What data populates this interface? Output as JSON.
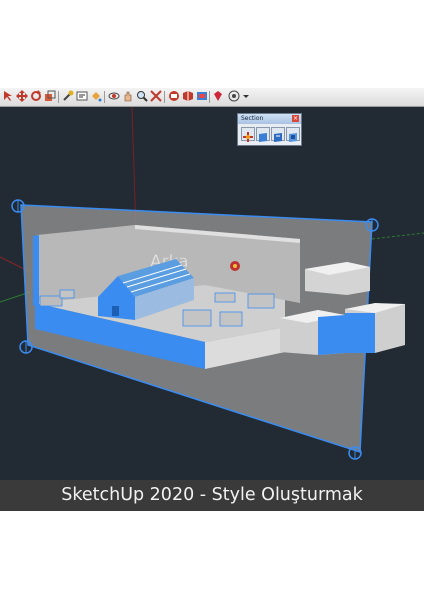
{
  "toolbar": {
    "icons": [
      "select-icon",
      "move-icon",
      "rotate-icon",
      "scale-icon",
      "tape-icon",
      "text-icon",
      "paint-icon",
      "orbit-icon",
      "pan-icon",
      "zoom-icon",
      "zoom-extents-icon",
      "warehouse-icon",
      "extension-icon",
      "model-info-icon",
      "ruby-icon",
      "location-icon",
      "dropdown-arrow-icon"
    ]
  },
  "section_palette": {
    "title": "Section",
    "buttons": [
      "section-plane-icon",
      "display-section-planes-icon",
      "display-section-cuts-icon",
      "display-section-fill-icon"
    ]
  },
  "model": {
    "wall_text": "Arka"
  },
  "caption": "SketchUp 2020 - Style Oluşturmak",
  "colors": {
    "viewport_bg": "#222a33",
    "selection_blue": "#3b8cf0",
    "section_plane": "#8f8f8f"
  }
}
